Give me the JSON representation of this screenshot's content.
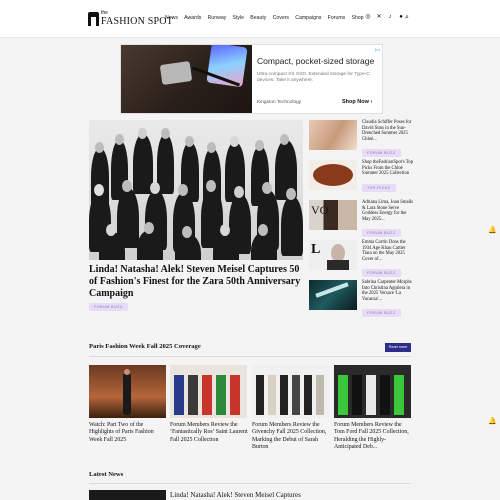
{
  "header": {
    "logo_small": "the",
    "logo_name": "FASHION SPOT",
    "nav": [
      "News",
      "Awards",
      "Runway",
      "Style",
      "Beauty",
      "Covers",
      "Campaigns",
      "Forums",
      "Shop"
    ],
    "social_icons": [
      "instagram-icon",
      "x-icon",
      "tiktok-icon",
      "facebook-icon"
    ]
  },
  "ad": {
    "title": "Compact, pocket-sized storage",
    "text": "Ultra-compact XS SSD. Extended storage for Type-C devices. Take it anywhere.",
    "advertiser": "Kingston Technology",
    "button": "Shop Now ›",
    "adchoices": "▷×"
  },
  "hero": {
    "title": "Linda! Natasha! Alek! Steven Meisel Captures 50 of Fashion's Finest for the Zara 50th Anniversary Campaign",
    "tag": "FORUM BUZZ"
  },
  "side_items": [
    {
      "title": "Claudia Schiffer Poses for David Sims in the Sun-Drenched Summer 2025 Chloé...",
      "tag": "FORUM BUZZ"
    },
    {
      "title": "Shop theFashionSpot's Top Picks From the Chloé Summer 2025 Collection",
      "tag": "TOP PICKS"
    },
    {
      "title": "Adriana Lima, Joan Smalls & Lara Stone Serve Goddess Energy for the May 2025...",
      "tag": "FORUM BUZZ"
    },
    {
      "title": "Emma Corrin Dons the 1934 Age Khan Cartier Tiara on the May 2025 Cover of...",
      "tag": "FORUM BUZZ"
    },
    {
      "title": "Sabrina Carpenter Morphs Into Christina Aguilera in the 2025 Versace 'La Vacanza'...",
      "tag": "FORUM BUZZ"
    }
  ],
  "section": {
    "title": "Paris Fashion Week Fall 2025 Coverage",
    "button": "Read more",
    "cards": [
      {
        "title": "Watch: Part Two of the Highlights of Paris Fashion Week Fall 2025"
      },
      {
        "title": "Forum Members Review the ‘Fantastically Ros’ Saint Laurent Fall 2025 Collection"
      },
      {
        "title": "Forum Members Review the Givenchy Fall 2025 Collection, Marking the Debut of Sarah Burton"
      },
      {
        "title": "Forum Members Review the Tom Ford Fall 2025 Collection, Heralding the Highly-Anticipated Deb..."
      }
    ]
  },
  "latest": {
    "title": "Latest News",
    "first_item": "Linda! Natasha! Alek! Steven Meisel Captures"
  },
  "colors": {
    "tag_bg": "#e6dcf5",
    "tag_fg": "#8c6cc5",
    "read_more_bg": "#2c2c8a"
  }
}
